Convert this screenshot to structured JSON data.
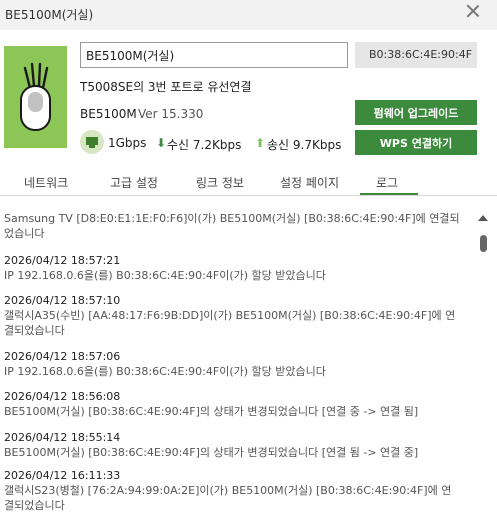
{
  "window": {
    "title": "BE5100M(거실)"
  },
  "device": {
    "name_value": "BE5100M(거실)",
    "mac": "B0:38:6C:4E:90:4F",
    "port_info": "T5008SE의 3번 포트로 유선연결",
    "model": "BE5100M",
    "version": "Ver 15.330",
    "firmware_button": "펌웨어 업그레이드",
    "wps_button": "WPS 연결하기",
    "link_speed": "1Gbps",
    "rx": "수신  7.2Kbps",
    "tx": "송신  9.7Kbps",
    "icon_name": "router-device-icon",
    "accent_color": "#3c8b3c",
    "icon_bg_color": "#8cc657"
  },
  "tabs": [
    "네트워크",
    "고급 설정",
    "링크 정보",
    "설정 페이지",
    "로그"
  ],
  "active_tab": "로그",
  "log": [
    {
      "time": "",
      "lines": [
        "Samsung TV [D8:E0:E1:1E:F0:F6]이(가) BE5100M(거실) [B0:38:6C:4E:90:4F]에 연결되",
        "었습니다"
      ]
    },
    {
      "time": "2026/04/12 18:57:21",
      "lines": [
        "IP 192.168.0.6을(를) B0:38:6C:4E:90:4F이(가) 할당 받았습니다"
      ]
    },
    {
      "time": "2026/04/12 18:57:10",
      "lines": [
        "갤럭시A35(수빈) [AA:48:17:F6:9B:DD]이(가) BE5100M(거실) [B0:38:6C:4E:90:4F]에 연",
        "결되었습니다"
      ]
    },
    {
      "time": "2026/04/12 18:57:06",
      "lines": [
        "IP 192.168.0.6을(를) B0:38:6C:4E:90:4F이(가) 할당 받았습니다"
      ]
    },
    {
      "time": "2026/04/12 18:56:08",
      "lines": [
        "BE5100M(거실) [B0:38:6C:4E:90:4F]의 상태가 변경되었습니다 [연결 중 -> 연결 됨]"
      ]
    },
    {
      "time": "2026/04/12 18:55:14",
      "lines": [
        "BE5100M(거실) [B0:38:6C:4E:90:4F]의 상태가 변경되었습니다 [연결 됨 -> 연결 중]"
      ]
    },
    {
      "time": "2026/04/12 16:11:33",
      "lines": [
        "갤럭시S23(병철) [76:2A:94:99:0A:2E]이(가) BE5100M(거실) [B0:38:6C:4E:90:4F]에 연",
        "결되었습니다"
      ]
    }
  ]
}
